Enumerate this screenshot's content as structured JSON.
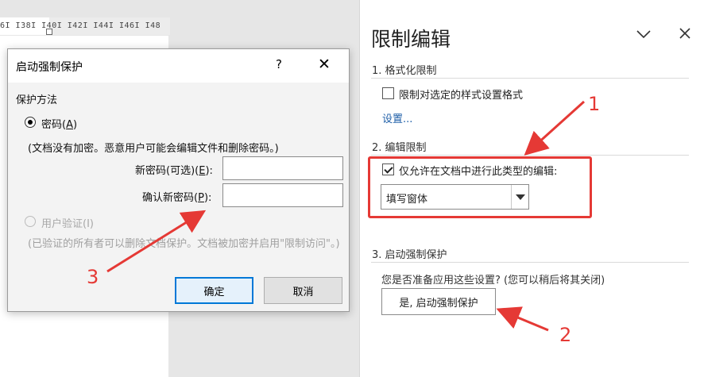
{
  "ruler": {
    "ticks": "6I  I38I  I40I  I42I  I44I  I46I  I48"
  },
  "dialog": {
    "title": "启动强制保护",
    "help": "?",
    "close": "✕",
    "section_label": "保护方法",
    "password_option": {
      "label": "密码",
      "key": "A"
    },
    "password_note": "(文档没有加密。恶意用户可能会编辑文件和删除密码。)",
    "new_password": {
      "label": "新密码(可选)",
      "key": "E",
      "value": ""
    },
    "confirm_password": {
      "label": "确认新密码",
      "key": "P",
      "value": ""
    },
    "user_auth_option": {
      "label": "用户验证(I)"
    },
    "user_auth_note": "(已验证的所有者可以删除文档保护。文档被加密并启用\"限制访问\"。)",
    "ok_label": "确定",
    "cancel_label": "取消"
  },
  "pane": {
    "title": "限制编辑",
    "collapse_icon": "chevron-down-icon",
    "close_icon": "close-icon",
    "section1": {
      "heading": "1. 格式化限制",
      "checkbox_label": "限制对选定的样式设置格式",
      "checkbox_checked": false,
      "settings_link": "设置..."
    },
    "section2": {
      "heading": "2. 编辑限制",
      "checkbox_label": "仅允许在文档中进行此类型的编辑:",
      "checkbox_checked": true,
      "select_value": "填写窗体"
    },
    "section3": {
      "heading": "3. 启动强制保护",
      "question": "您是否准备应用这些设置? (您可以稍后将其关闭)",
      "button_label": "是, 启动强制保护"
    }
  },
  "annotations": {
    "one": "1",
    "two": "2",
    "three": "3",
    "color": "#e53935"
  }
}
